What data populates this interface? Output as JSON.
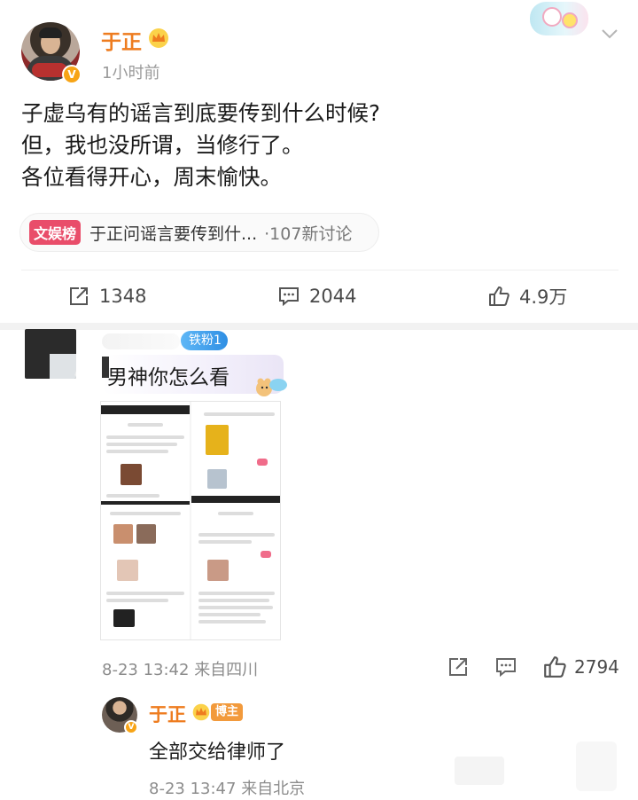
{
  "post": {
    "author": "于正",
    "time_ago": "1小时前",
    "verified_badge": "V",
    "lines": [
      "子虚乌有的谣言到底要传到什么时候?",
      "但，我也没所谓，当修行了。",
      "各位看得开心，周末愉快。"
    ],
    "topic": {
      "tag": "文娱榜",
      "title": "于正问谣言要传到什...",
      "count": "·107新讨论"
    },
    "actions": {
      "share_count": "1348",
      "comment_count": "2044",
      "like_count": "4.9万"
    }
  },
  "comment": {
    "fan_badge": "铁粉1",
    "text": "男神你怎么看",
    "date": "8-23 13:42",
    "location": "来自四川",
    "like_count": "2794"
  },
  "reply": {
    "author": "于正",
    "author_badge": "博主",
    "text": "全部交给律师了",
    "date": "8-23 13:47",
    "location": "来自北京"
  },
  "colors": {
    "author_orange": "#ee7c1f",
    "topic_tag_red": "#e94d6a",
    "fan_badge_blue": "#2f8fe4",
    "meta_gray": "#8c8c8c"
  },
  "icons": [
    "chevron-down-icon",
    "crown-icon",
    "share-icon",
    "comment-icon",
    "like-icon"
  ]
}
